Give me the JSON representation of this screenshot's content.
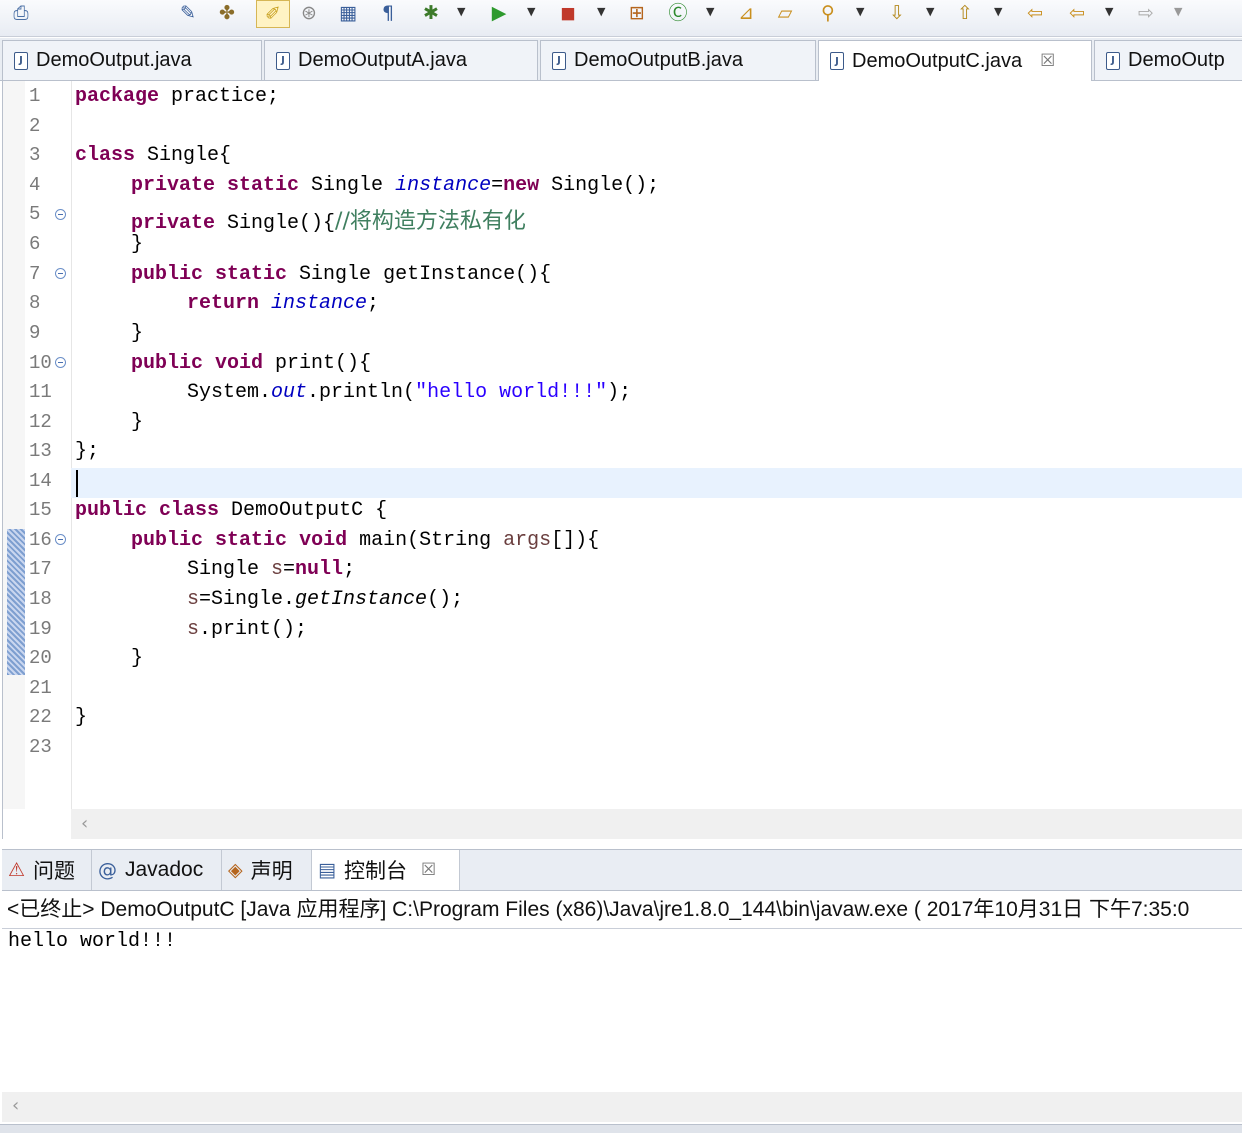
{
  "toolbar": {
    "icons": [
      "printer-icon",
      "pin-icon",
      "toggle-mark-icon",
      "highlight-icon",
      "breakpoint-icon",
      "block-select-icon",
      "show-whitespace-icon",
      "debug-icon",
      "run-icon",
      "coverage-icon",
      "external-tools-icon",
      "new-class-icon",
      "open-type-icon",
      "open-task-icon",
      "search-icon",
      "next-annotation-icon",
      "previous-annotation-icon",
      "last-edit-icon",
      "back-icon",
      "forward-icon"
    ]
  },
  "editor_tabs": [
    {
      "label": "DemoOutput.java"
    },
    {
      "label": "DemoOutputA.java"
    },
    {
      "label": "DemoOutputB.java"
    },
    {
      "label": "DemoOutputC.java",
      "active": true,
      "close": "☒"
    },
    {
      "label": "DemoOutp"
    }
  ],
  "code": {
    "line_numbers": [
      "1",
      "2",
      "3",
      "4",
      "5",
      "6",
      "7",
      "8",
      "9",
      "10",
      "11",
      "12",
      "13",
      "14",
      "15",
      "16",
      "17",
      "18",
      "19",
      "20",
      "21",
      "22",
      "23"
    ],
    "l1": {
      "kw": "package",
      "rest": " practice;"
    },
    "l3": {
      "kw": "class",
      "rest": " Single{"
    },
    "l4": {
      "kw1": "private",
      "kw2": "static",
      "type": " Single ",
      "field": "instance",
      "eq": "=",
      "kw3": "new",
      "rest": " Single();"
    },
    "l5": {
      "kw": "private",
      "rest": " Single(){",
      "comment": "//将构造方法私有化"
    },
    "l6": {
      "text": "}"
    },
    "l7": {
      "kw1": "public",
      "kw2": "static",
      "rest": " Single getInstance(){"
    },
    "l8": {
      "kw": "return",
      "field": "instance",
      "end": ";"
    },
    "l9": {
      "text": "}"
    },
    "l10": {
      "kw1": "public",
      "kw2": "void",
      "rest": " print(){"
    },
    "l11": {
      "pre": "System.",
      "field": "out",
      "mid": ".println(",
      "str": "\"hello world!!!\"",
      "end": ");"
    },
    "l12": {
      "text": "}"
    },
    "l13": {
      "text": "};"
    },
    "l15": {
      "kw1": "public",
      "kw2": "class",
      "rest": " DemoOutputC {"
    },
    "l16": {
      "kw1": "public",
      "kw2": "static",
      "kw3": "void",
      "mid": " main(String ",
      "var": "args",
      "end": "[]){"
    },
    "l17": {
      "pre": "Single ",
      "var": "s",
      "eq": "=",
      "kw": "null",
      "end": ";"
    },
    "l18": {
      "var": "s",
      "mid": "=Single.",
      "method": "getInstance",
      "end": "();"
    },
    "l19": {
      "var": "s",
      "end": ".print();"
    },
    "l20": {
      "text": "}"
    },
    "l22": {
      "text": "}"
    }
  },
  "views_tabs": [
    {
      "icon": "problems-icon",
      "glyph": "⚠",
      "label": "问题"
    },
    {
      "icon": "javadoc-icon",
      "glyph": "@",
      "label": "Javadoc"
    },
    {
      "icon": "declaration-icon",
      "glyph": "◈",
      "label": "声明"
    },
    {
      "icon": "console-icon",
      "glyph": "▤",
      "label": "控制台",
      "active": true,
      "close": "☒"
    }
  ],
  "console": {
    "description": "<已终止> DemoOutputC [Java 应用程序] C:\\Program Files (x86)\\Java\\jre1.8.0_144\\bin\\javaw.exe ( 2017年10月31日 下午7:35:0",
    "output": "hello world!!!"
  }
}
